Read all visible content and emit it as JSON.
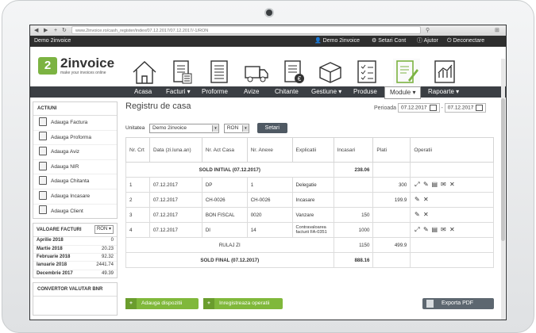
{
  "browser": {
    "url": "www.2invoice.ro/cash_register/index/07.12.2017/07.12.2017/-1/RON",
    "nav_back": "◀",
    "nav_forward": "▶",
    "nav_add": "+"
  },
  "topbar": {
    "brand": "Demo 2invoice",
    "user": "Demo 2invoice",
    "settings": "Setari Cont",
    "help": "Ajutor",
    "logout": "Deconectare"
  },
  "logo": {
    "mark": "2",
    "name": "2invoice",
    "tagline": "make your invoices online"
  },
  "menu": [
    {
      "label": "Acasa"
    },
    {
      "label": "Facturi ▾"
    },
    {
      "label": "Proforme"
    },
    {
      "label": "Avize"
    },
    {
      "label": "Chitante"
    },
    {
      "label": "Gestiune ▾"
    },
    {
      "label": "Produse"
    },
    {
      "label": "Module ▾"
    },
    {
      "label": "Rapoarte ▾"
    }
  ],
  "sidebar": {
    "actions_title": "ACTIUNI",
    "actions": [
      "Adauga Factura",
      "Adauga Proforma",
      "Adauga Aviz",
      "Adauga NIR",
      "Adauga Chitanta",
      "Adauga Incasare",
      "Adauga Client"
    ],
    "values_title": "VALOARE FACTURI",
    "values_currency": "RON",
    "values": [
      {
        "month": "Aprilie 2018",
        "value": "0"
      },
      {
        "month": "Martie 2018",
        "value": "20.23"
      },
      {
        "month": "Februarie 2018",
        "value": "92.32"
      },
      {
        "month": "Ianuarie 2018",
        "value": "2441.74"
      },
      {
        "month": "Decembrie 2017",
        "value": "49.39"
      }
    ],
    "converter_title": "CONVERTOR VALUTAR BNR"
  },
  "main": {
    "title": "Registru de casa",
    "period_label": "Perioada",
    "date_from": "07.12.2017",
    "date_sep": "-",
    "date_to": "07.12.2017",
    "unit_label": "Unitatea",
    "unit_value": "Demo 2invoice",
    "currency": "RON",
    "set_button": "Setari",
    "columns": [
      "Nr. Crt",
      "Data (zi.luna.an)",
      "Nr. Act Casa",
      "Nr. Anexe",
      "Explicatii",
      "Incasari",
      "Plati",
      "Operatii"
    ],
    "sold_initial_label": "SOLD INITIAL (07.12.2017)",
    "sold_initial_value": "238.06",
    "rows": [
      {
        "nr": "1",
        "date": "07.12.2017",
        "act": "DP",
        "anexe": "1",
        "expl": "Delegatie",
        "incasari": "",
        "plati": "300"
      },
      {
        "nr": "2",
        "date": "07.12.2017",
        "act": "CH-0026",
        "anexe": "CH-0026",
        "expl": "Incasare",
        "incasari": "",
        "plati": "199.9"
      },
      {
        "nr": "3",
        "date": "07.12.2017",
        "act": "BON FISCAL",
        "anexe": "0020",
        "expl": "Vanzare",
        "incasari": "150",
        "plati": ""
      },
      {
        "nr": "4",
        "date": "07.12.2017",
        "act": "DI",
        "anexe": "14",
        "expl": "Contravaloarea facturii FA-0351",
        "incasari": "1000",
        "plati": ""
      }
    ],
    "rulaj_label": "RULAJ ZI",
    "rulaj_incasari": "1150",
    "rulaj_plati": "499.9",
    "sold_final_label": "SOLD FINAL (07.12.2017)",
    "sold_final_value": "888.16",
    "add_button": "Adauga dispozitii",
    "register_button": "Inregistreaza operatii",
    "export_button": "Exporta PDF"
  }
}
